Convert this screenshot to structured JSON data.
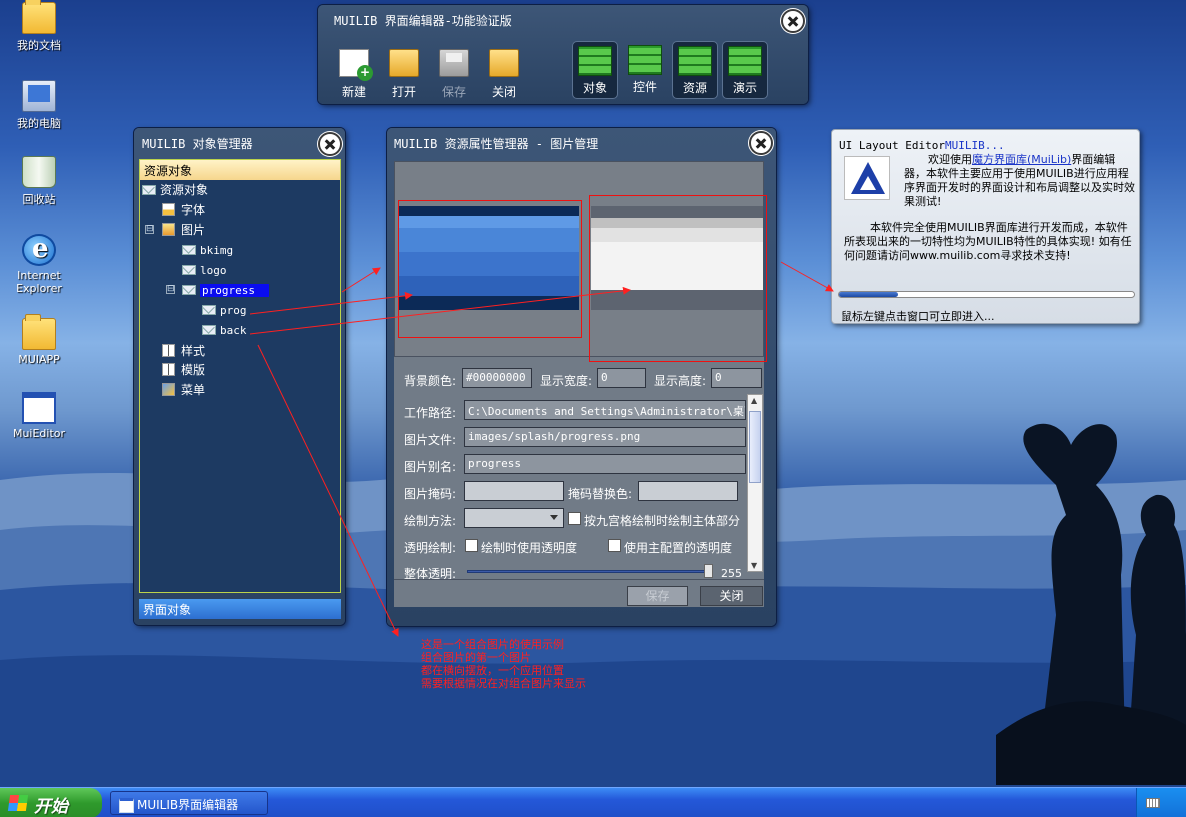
{
  "desktop": {
    "icons": [
      {
        "label": "我的文档",
        "icon": "folder-icon"
      },
      {
        "label": "我的电脑",
        "icon": "computer-icon"
      },
      {
        "label": "回收站",
        "icon": "recycle-bin-icon"
      },
      {
        "label": "Internet Explorer",
        "icon": "ie-icon"
      },
      {
        "label": "MUIAPP",
        "icon": "folder-icon"
      },
      {
        "label": "MuiEditor",
        "icon": "window-icon"
      }
    ]
  },
  "main_window": {
    "title": "MUILIB 界面编辑器-功能验证版",
    "tools": [
      {
        "label": "新建",
        "icon": "new-file-icon"
      },
      {
        "label": "打开",
        "icon": "open-folder-icon"
      },
      {
        "label": "保存",
        "icon": "save-icon"
      },
      {
        "label": "关闭",
        "icon": "close-folder-icon"
      }
    ],
    "modes": [
      {
        "label": "对象",
        "icon": "bricks-icon"
      },
      {
        "label": "控件",
        "icon": "bricks-icon"
      },
      {
        "label": "资源",
        "icon": "bricks-icon"
      },
      {
        "label": "演示",
        "icon": "bricks-icon"
      }
    ]
  },
  "object_manager": {
    "title": "MUILIB 对象管理器",
    "header": "资源对象",
    "footer": "界面对象",
    "tree": {
      "root": "资源对象",
      "font": "字体",
      "image": "图片",
      "bkimg": "bkimg",
      "logo": "logo",
      "progress": "progress",
      "prog": "prog",
      "back": "back",
      "style": "样式",
      "template": "模版",
      "menu": "菜单",
      "expander_open": "⊟"
    }
  },
  "resource_manager": {
    "title": "MUILIB 资源属性管理器 -  图片管理",
    "bg_color_label": "背景颜色:",
    "bg_color_value": "#00000000",
    "width_label": "显示宽度:",
    "width_value": "0",
    "height_label": "显示高度:",
    "height_value": "0",
    "path_label": "工作路径:",
    "path_value": "C:\\Documents and Settings\\Administrator\\桌面\\M",
    "file_label": "图片文件:",
    "file_value": "images/splash/progress.png",
    "alias_label": "图片别名:",
    "alias_value": "progress",
    "mask_label": "图片掩码:",
    "mask_value": "",
    "mask_replace_label": "掩码替换色:",
    "mask_replace_value": "",
    "draw_method_label": "绘制方法:",
    "draw_method_value": "",
    "nine_grid_label": "按九宫格绘制时绘制主体部分",
    "transparent_label": "透明绘制:",
    "use_alpha_label": "绘制时使用透明度",
    "use_main_alpha_label": "使用主配置的透明度",
    "overall_alpha_label": "整体透明:",
    "overall_alpha_value": "255",
    "overall_alpha_fraction": 1.0,
    "save_label": "保存",
    "close_label": "关闭"
  },
  "splash": {
    "title_prefix": "UI Layout Editor",
    "title_link": "MUILIB...",
    "line1_pre": "欢迎使用",
    "line1_link": "魔方界面库(MuiLib)",
    "line1_post": "界面编辑器，本软件主要应用于使用MUILIB进行应用程序界面开发时的界面设计和布局调整以及实时效果测试!",
    "line2": "本软件完全使用MUILIB界面库进行开发而成，本软件所表现出来的一切特性均为MUILIB特性的具体实现! 如有任何问题请访问www.muilib.com寻求技术支持!",
    "progress_fraction": 0.2,
    "tip": "鼠标左键点击窗口可立即进入..."
  },
  "annotation": {
    "lines": [
      "这是一个组合图片的使用示例",
      "组合图片的第一个图片",
      "都在横向摆放，一个应用位置",
      "需要根据情况在对组合图片来显示"
    ]
  },
  "taskbar": {
    "start_label": "开始",
    "task_item": "MUILIB界面编辑器"
  },
  "colors": {
    "accent": "#0a0cf0",
    "annotation": "#ff2020",
    "progress": "#1d4aa4"
  }
}
